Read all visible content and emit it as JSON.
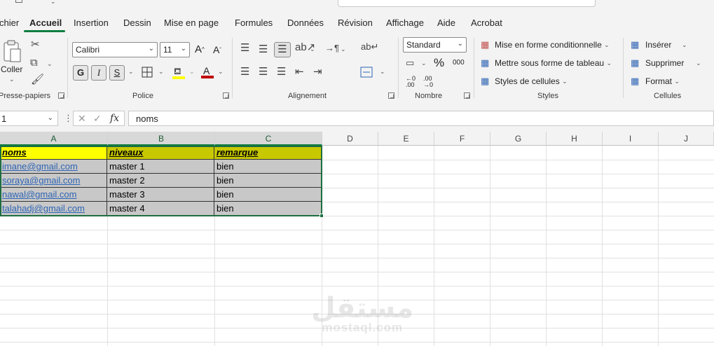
{
  "tabs": [
    {
      "label": "chier",
      "active": false
    },
    {
      "label": "Accueil",
      "active": true
    },
    {
      "label": "Insertion",
      "active": false
    },
    {
      "label": "Dessin",
      "active": false
    },
    {
      "label": "Mise en page",
      "active": false
    },
    {
      "label": "Formules",
      "active": false
    },
    {
      "label": "Données",
      "active": false
    },
    {
      "label": "Révision",
      "active": false
    },
    {
      "label": "Affichage",
      "active": false
    },
    {
      "label": "Aide",
      "active": false
    },
    {
      "label": "Acrobat",
      "active": false
    }
  ],
  "ribbon": {
    "clipboard": {
      "paste_label": "Coller",
      "group_label": "Presse-papiers"
    },
    "font": {
      "font_name": "Calibri",
      "font_size": "11",
      "bold": "G",
      "italic": "I",
      "underline": "S",
      "group_label": "Police"
    },
    "alignment": {
      "group_label": "Alignement"
    },
    "number": {
      "format": "Standard",
      "percent": "%",
      "thousands": "000",
      "inc_decimal": "←0 .00",
      "dec_decimal": ".00 →0",
      "group_label": "Nombre"
    },
    "styles": {
      "conditional": "Mise en forme conditionnelle",
      "table": "Mettre sous forme de tableau",
      "cell_styles": "Styles de cellules",
      "group_label": "Styles"
    },
    "cells": {
      "insert": "Insérer",
      "delete": "Supprimer",
      "format": "Format",
      "group_label": "Cellules"
    }
  },
  "formula_bar": {
    "name_box": "1",
    "fx": "fx",
    "content": "noms"
  },
  "columns": [
    "A",
    "B",
    "C",
    "D",
    "E",
    "F",
    "G",
    "H",
    "I",
    "J"
  ],
  "table": {
    "headers": [
      "noms",
      "niveaux",
      "remarque"
    ],
    "rows": [
      [
        "imane@gmail.com",
        "master 1",
        "bien"
      ],
      [
        "soraya@gmail.com",
        "master 2",
        "bien"
      ],
      [
        "nawal@gmail.com",
        "master 3",
        "bien"
      ],
      [
        "talahadj@gmail.com",
        "master 4",
        "bien"
      ]
    ]
  },
  "colors": {
    "accent": "#107c41",
    "header_yellow": "#ffff00",
    "header_olive": "#c8c800",
    "row_gray": "#c8c8c8",
    "link": "#2e64b4"
  },
  "watermark": {
    "arabic": "مستقل",
    "latin": "mostaql.com"
  }
}
